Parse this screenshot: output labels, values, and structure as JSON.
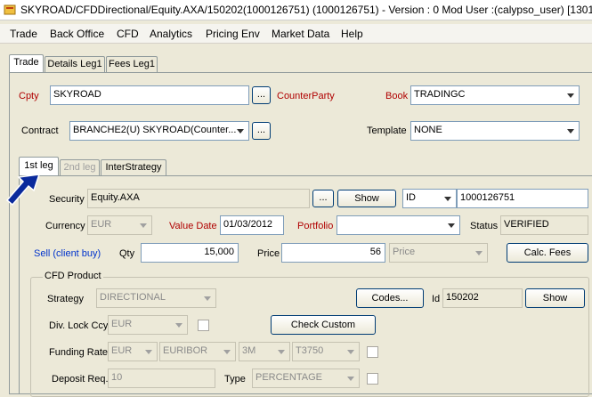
{
  "window": {
    "title": "SKYROAD/CFDDirectional/Equity.AXA/150202(1000126751)  (1000126751) - Version : 0 Mod User :(calypso_user)  [13010"
  },
  "menu": [
    "Trade",
    "Back Office",
    "CFD",
    "Analytics",
    "Pricing Env",
    "Market Data",
    "Help"
  ],
  "top_tabs": [
    "Trade",
    "Details Leg1",
    "Fees Leg1"
  ],
  "header": {
    "cpty_label": "Cpty",
    "cpty_value": "SKYROAD",
    "counterparty_label": "CounterParty",
    "book_label": "Book",
    "book_value": "TRADINGC",
    "contract_label": "Contract",
    "contract_value": "BRANCHE2(U) SKYROAD(Counter...",
    "template_label": "Template",
    "template_value": "NONE",
    "ellipsis": "..."
  },
  "leg_tabs": [
    "1st leg",
    "2nd leg",
    "InterStrategy"
  ],
  "leg": {
    "security_label": "Security",
    "security_value": "Equity.AXA",
    "show_label": "Show",
    "id_type": "ID",
    "id_value": "1000126751",
    "currency_label": "Currency",
    "currency_value": "EUR",
    "value_date_label": "Value Date",
    "value_date_value": "01/03/2012",
    "portfolio_label": "Portfolio",
    "portfolio_value": "",
    "status_label": "Status",
    "status_value": "VERIFIED",
    "side_label": "Sell (client buy)",
    "qty_label": "Qty",
    "qty_value": "15,000",
    "price_label": "Price",
    "price_value": "56",
    "price_type": "Price",
    "calc_fees_label": "Calc. Fees"
  },
  "cfd": {
    "group_title": "CFD Product",
    "strategy_label": "Strategy",
    "strategy_value": "DIRECTIONAL",
    "codes_label": "Codes...",
    "id_label": "Id",
    "id_value": "150202",
    "show_label": "Show",
    "div_lock_label": "Div. Lock Ccy",
    "div_lock_value": "EUR",
    "check_custom_label": "Check Custom",
    "funding_label": "Funding Rate",
    "funding_ccy": "EUR",
    "funding_index": "EURIBOR",
    "funding_tenor": "3M",
    "funding_source": "T3750",
    "deposit_label": "Deposit Req.",
    "deposit_value": "10",
    "type_label": "Type",
    "type_value": "PERCENTAGE"
  },
  "colors": {
    "label_red": "#b00000",
    "label_blue": "#0033cc",
    "pointer_arrow": "#0a2a9c"
  }
}
